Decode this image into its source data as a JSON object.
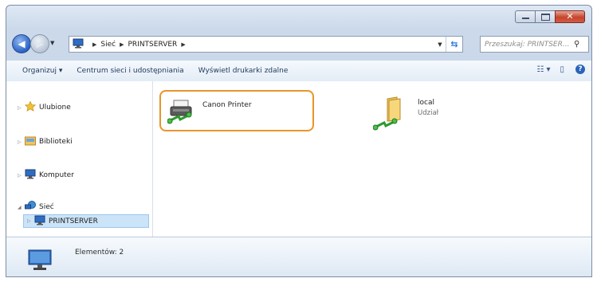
{
  "window": {
    "caption_buttons": {
      "minimize": "minimize-icon",
      "maximize": "maximize-icon",
      "close": "close-icon"
    }
  },
  "navigation": {
    "back_icon": "back-arrow-icon",
    "forward_icon": "forward-arrow-icon",
    "breadcrumb": [
      "Sieć",
      "PRINTSERVER"
    ],
    "search_placeholder": "Przeszukaj: PRINTSER..."
  },
  "toolbar": {
    "organize": "Organizuj ▾",
    "network_center": "Centrum sieci i udostępniania",
    "remote_printers": "Wyświetl drukarki zdalne"
  },
  "sidebar": {
    "items": [
      {
        "label": "Ulubione",
        "icon": "star-icon"
      },
      {
        "label": "Biblioteki",
        "icon": "library-icon"
      },
      {
        "label": "Komputer",
        "icon": "computer-icon"
      },
      {
        "label": "Sieć",
        "icon": "network-icon"
      },
      {
        "label": "PRINTSERVER",
        "icon": "computer-icon"
      }
    ]
  },
  "content": {
    "items": [
      {
        "label": "Canon Printer",
        "icon": "printer-share-icon"
      },
      {
        "label": "local",
        "sublabel": "Udział",
        "icon": "folder-share-icon"
      }
    ]
  },
  "details": {
    "count_text": "Elementów: 2"
  },
  "colors": {
    "highlight": "#e8952a",
    "accent": "#2a64b8",
    "selection": "#cce4f7"
  }
}
